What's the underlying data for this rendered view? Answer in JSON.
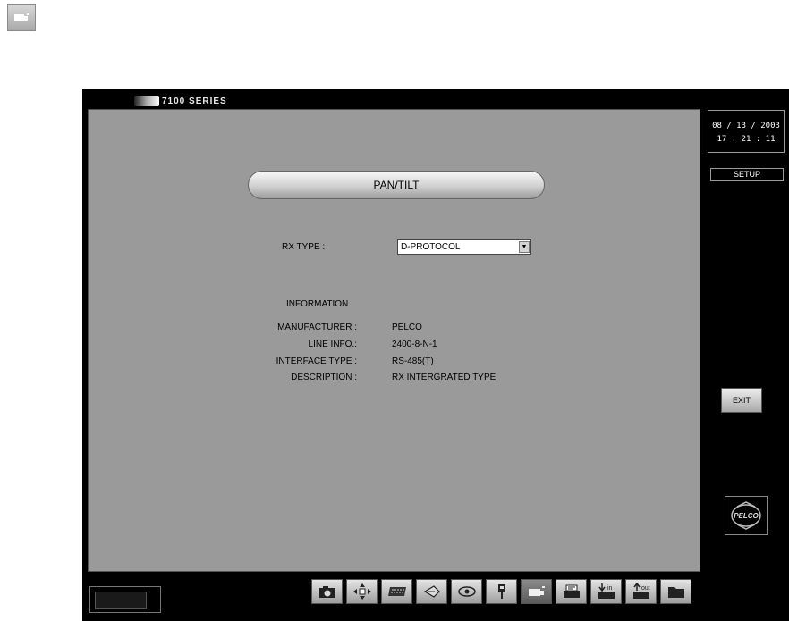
{
  "top_icon": {
    "name": "camera-monitor-icon"
  },
  "brand": {
    "text": "7100 SERIES"
  },
  "page": {
    "title": "PAN/TILT",
    "rx_type": {
      "label": "RX TYPE :",
      "value": "D-PROTOCOL"
    },
    "information": {
      "heading": "INFORMATION",
      "rows": [
        {
          "key": "MANUFACTURER :",
          "value": "PELCO"
        },
        {
          "key": "LINE INFO.:",
          "value": "2400-8-N-1"
        },
        {
          "key": "INTERFACE TYPE :",
          "value": "RS-485(T)"
        },
        {
          "key": "DESCRIPTION :",
          "value": "RX INTERGRATED TYPE"
        }
      ]
    }
  },
  "side": {
    "date": "08 / 13 / 2003",
    "time": "17 : 21 : 11",
    "mode": "SETUP",
    "exit_label": "EXIT",
    "logo_text": "PELCO"
  },
  "toolbar": [
    {
      "name": "camera-icon",
      "active": false
    },
    {
      "name": "move-arrows-icon",
      "active": false
    },
    {
      "name": "keyboard-icon",
      "active": false
    },
    {
      "name": "zoom-in-icon",
      "active": false
    },
    {
      "name": "eye-icon",
      "active": false
    },
    {
      "name": "connector-icon",
      "active": false
    },
    {
      "name": "pan-tilt-camera-icon",
      "active": true
    },
    {
      "name": "device-settings-icon",
      "active": false
    },
    {
      "name": "input-icon",
      "active": false
    },
    {
      "name": "output-icon",
      "active": false
    },
    {
      "name": "folder-icon",
      "active": false
    }
  ]
}
